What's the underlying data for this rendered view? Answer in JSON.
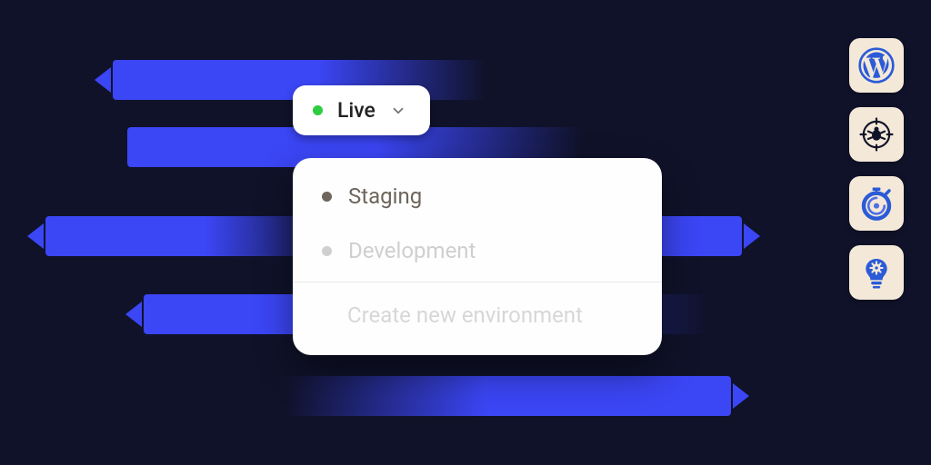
{
  "colors": {
    "background": "#10122a",
    "accent": "#3b46f5",
    "tile_background": "#f4e9d8",
    "status_live": "#2ecc40"
  },
  "env_switcher": {
    "current": {
      "label": "Live",
      "status_color": "#2ecc40"
    },
    "options": [
      {
        "label": "Staging"
      },
      {
        "label": "Development"
      }
    ],
    "create_label": "Create new environment"
  },
  "right_tiles": [
    {
      "icon": "wordpress-icon"
    },
    {
      "icon": "debug-target-icon"
    },
    {
      "icon": "stopwatch-icon"
    },
    {
      "icon": "idea-gear-icon"
    }
  ]
}
